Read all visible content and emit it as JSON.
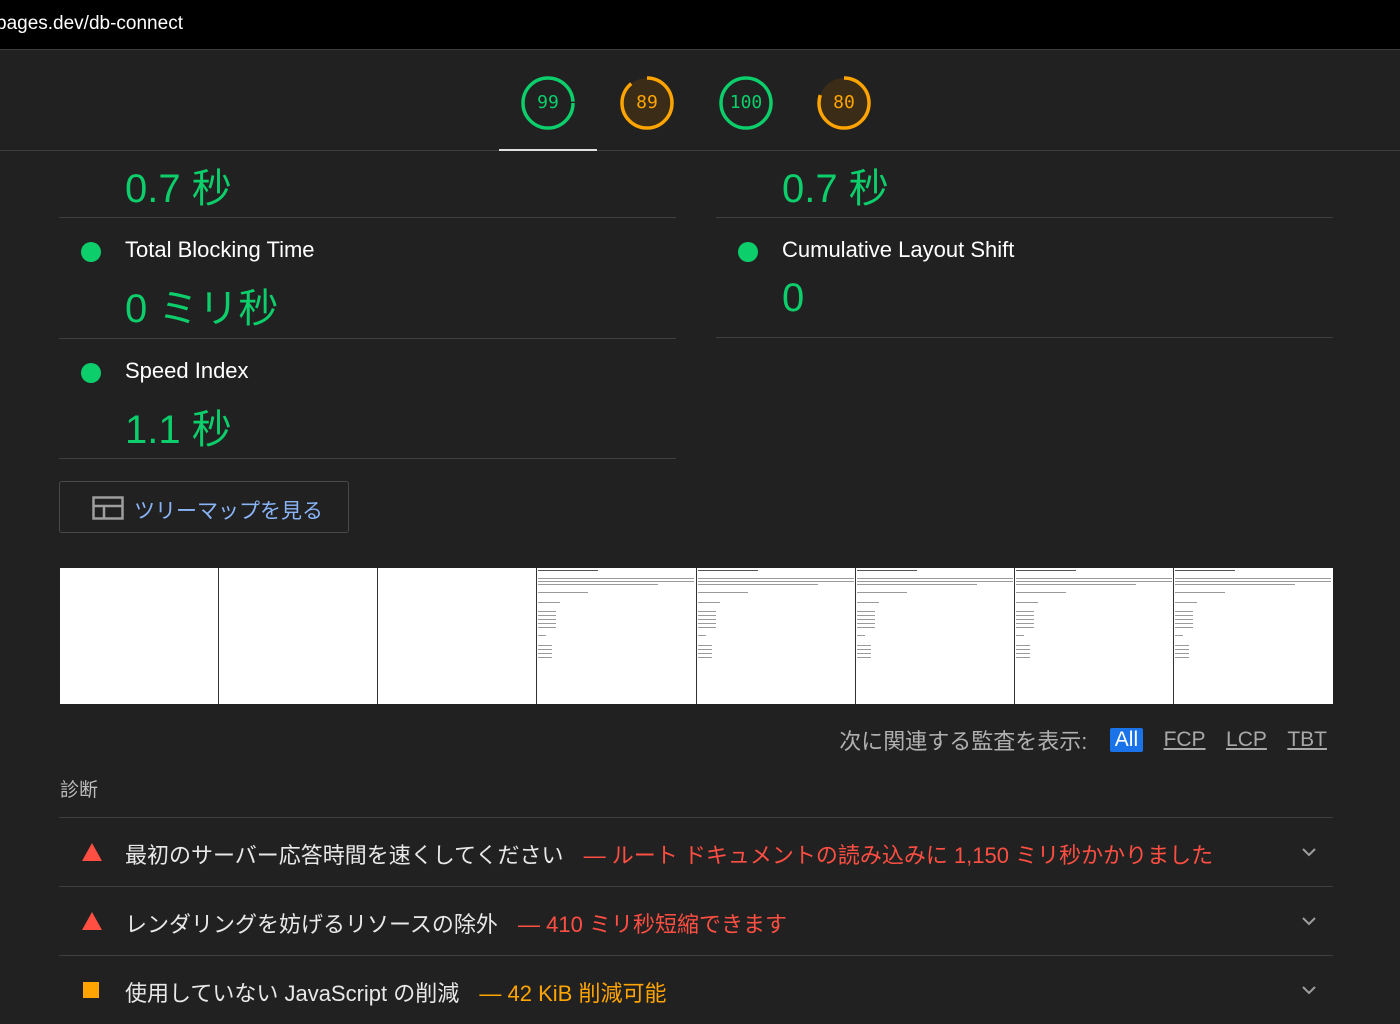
{
  "browser": {
    "url": "pages.dev/db-connect"
  },
  "gauges": [
    {
      "score": "99",
      "status": "pass",
      "fraction": 0.99
    },
    {
      "score": "89",
      "status": "average",
      "fraction": 0.89
    },
    {
      "score": "100",
      "status": "pass",
      "fraction": 1.0
    },
    {
      "score": "80",
      "status": "average",
      "fraction": 0.8
    }
  ],
  "metrics": {
    "top_left_value": "0.7 秒",
    "top_right_value": "0.7 秒",
    "tbt": {
      "label": "Total Blocking Time",
      "value": "0 ミリ秒"
    },
    "cls": {
      "label": "Cumulative Layout Shift",
      "value": "0"
    },
    "si": {
      "label": "Speed Index",
      "value": "1.1 秒"
    }
  },
  "treemap": {
    "label": "ツリーマップを見る",
    "icon": "treemap-icon"
  },
  "filter": {
    "label": "次に関連する監査を表示:",
    "options": [
      "All",
      "FCP",
      "LCP",
      "TBT"
    ],
    "selected": "All"
  },
  "diagnostics": {
    "title": "診断",
    "items": [
      {
        "severity": "fail",
        "title": "最初のサーバー応答時間を速くしてください",
        "desc": "— ルート ドキュメントの読み込みに 1,150 ミリ秒かかりました"
      },
      {
        "severity": "fail",
        "title": "レンダリングを妨げるリソースの除外",
        "desc": "— 410 ミリ秒短縮できます"
      },
      {
        "severity": "average",
        "title": "使用していない JavaScript の削減",
        "desc": "— 42 KiB 削減可能"
      }
    ]
  },
  "colors": {
    "pass": "#0cce6b",
    "average": "#ffa400",
    "fail": "#ff4e42",
    "link": "#8ab4f8",
    "accent": "#1a73e8"
  }
}
